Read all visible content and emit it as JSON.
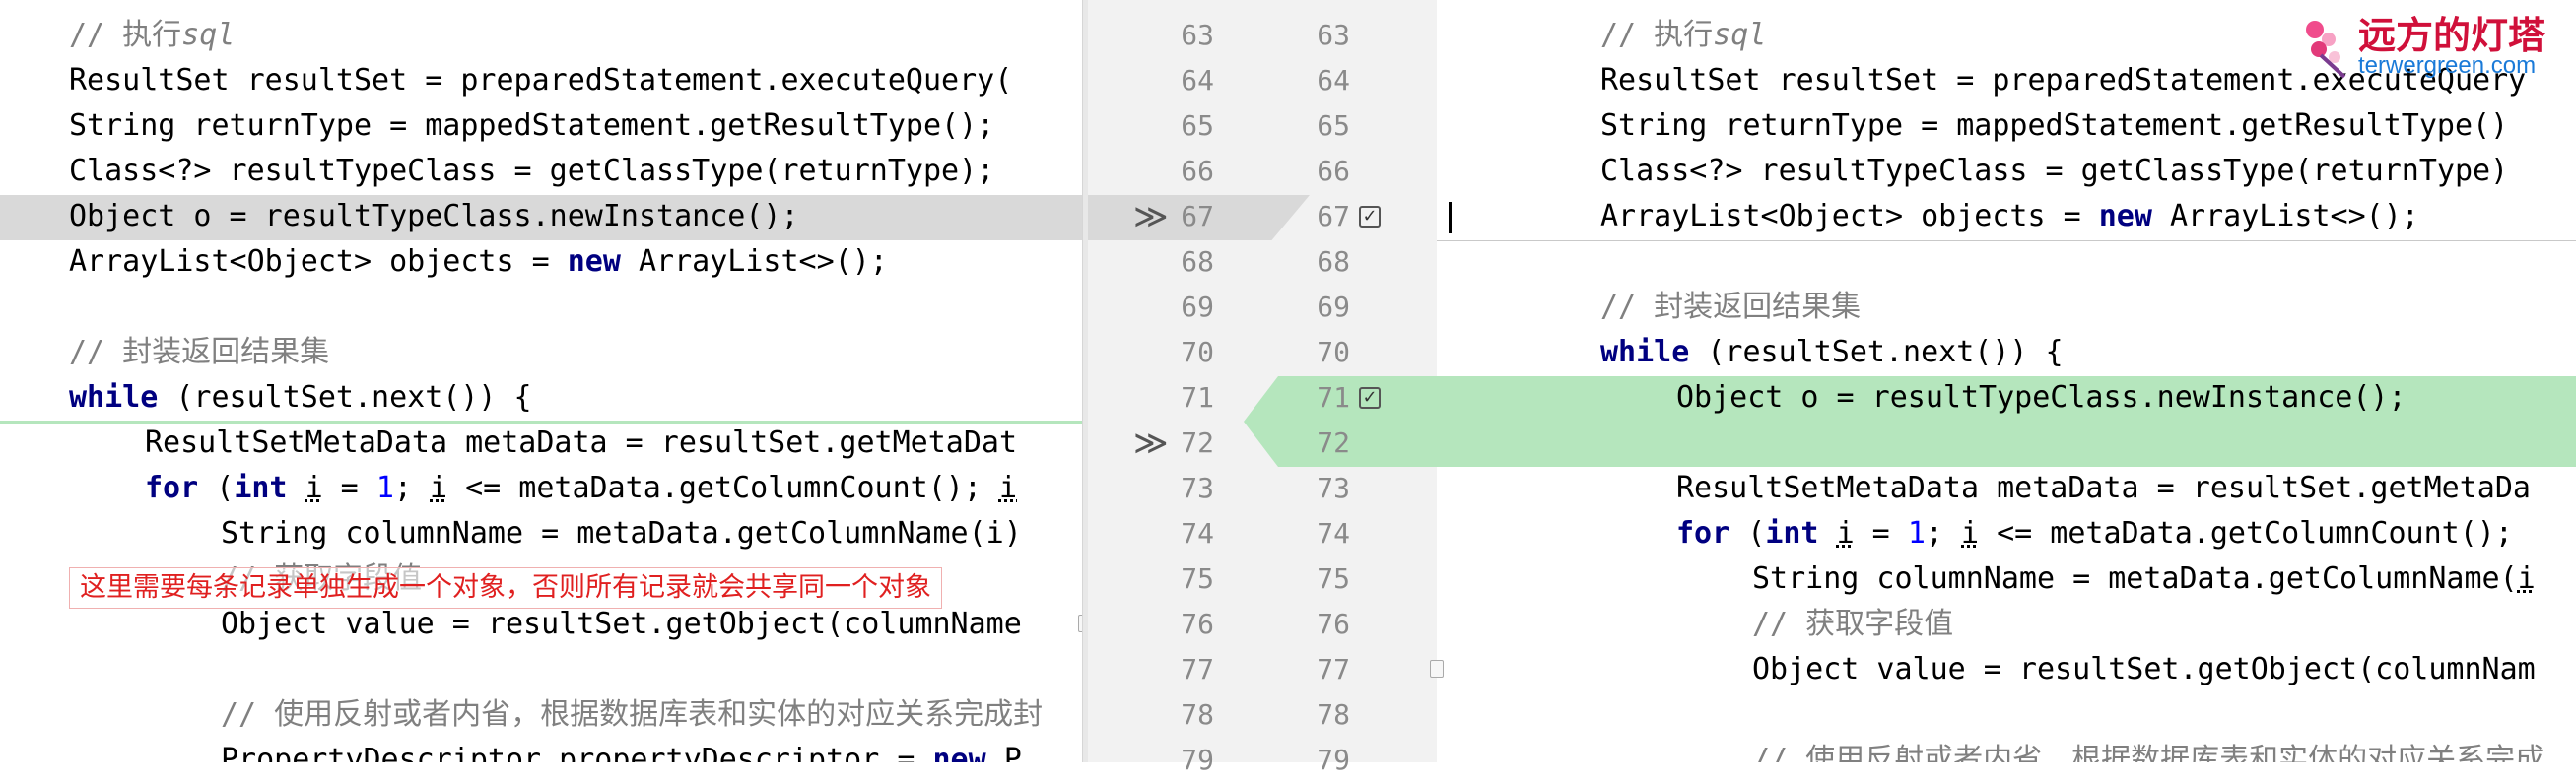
{
  "left": {
    "lines": [
      {
        "id": "l63",
        "text": ""
      },
      {
        "id": "l64",
        "text": "ResultSet resultSet = preparedStatement.executeQuery("
      },
      {
        "id": "l65",
        "text": "String returnType = mappedStatement.getResultType();"
      },
      {
        "id": "l66",
        "text": "Class<?> resultTypeClass = getClassType(returnType);"
      },
      {
        "id": "l67",
        "text": "Object o = resultTypeClass.newInstance();"
      },
      {
        "id": "l68a",
        "text": "ArrayList<Object> objects = "
      },
      {
        "id": "l68kw",
        "text": "new"
      },
      {
        "id": "l68b",
        "text": " ArrayList<>();"
      },
      {
        "id": "l70c",
        "text": "// 封装返回结果集"
      },
      {
        "id": "l71kw",
        "text": "while"
      },
      {
        "id": "l71b",
        "text": " (resultSet.next()) {"
      },
      {
        "id": "l72",
        "text": "ResultSetMetaData metaData = resultSet.getMetaDat"
      },
      {
        "id": "l73kw",
        "text": "for"
      },
      {
        "id": "l73b",
        "text": " ("
      },
      {
        "id": "l73int",
        "text": "int"
      },
      {
        "id": "l73c",
        "text": " "
      },
      {
        "id": "l73i1",
        "text": "i"
      },
      {
        "id": "l73d",
        "text": " = "
      },
      {
        "id": "l73one",
        "text": "1"
      },
      {
        "id": "l73e",
        "text": "; "
      },
      {
        "id": "l73i2",
        "text": "i"
      },
      {
        "id": "l73f",
        "text": " <= metaData.getColumnCount(); "
      },
      {
        "id": "l73i3",
        "text": "i"
      },
      {
        "id": "l74",
        "text": "String columnName = metaData.getColumnName(i)"
      },
      {
        "id": "l75c",
        "text": "// 获取字段值"
      },
      {
        "id": "l76",
        "text": "Object value = resultSet.getObject(columnName"
      },
      {
        "id": "l78c",
        "text": "// 使用反射或者内省，根据数据库表和实体的对应关系完成封"
      },
      {
        "id": "l79",
        "text": "PropertyDescriptor propertyDescriptor = "
      },
      {
        "id": "l79kw",
        "text": "new"
      },
      {
        "id": "l79b",
        "text": " P"
      }
    ],
    "comment_exec_prefix": "// 执行",
    "comment_exec_sql": "sql"
  },
  "right": {
    "comment_exec_prefix": "// 执行",
    "comment_exec_sql": "sql",
    "l64": "ResultSet resultSet = preparedStatement.executeQuery",
    "l65": "String returnType = mappedStatement.getResultType()",
    "l66": "Class<?> resultTypeClass = getClassType(returnType)",
    "l67a": "ArrayList<Object> objects = ",
    "l67kw": "new",
    "l67b": " ArrayList<>();",
    "l69c": "// 封装返回结果集",
    "l70kw": "while",
    "l70b": " (resultSet.next()) {",
    "l71": "Object o = resultTypeClass.newInstance();",
    "l73": "ResultSetMetaData metaData = resultSet.getMetaDa",
    "l74kw": "for",
    "l74b": " (",
    "l74int": "int",
    "l74c": " ",
    "l74i1": "i",
    "l74d": " = ",
    "l74one": "1",
    "l74e": "; ",
    "l74i2": "i",
    "l74f": " <= metaData.getColumnCount();",
    "l75": "String columnName = metaData.getColumnName(",
    "l75i": "i",
    "l76c": "// 获取字段值",
    "l77": "Object value = resultSet.getObject(columnNam",
    "l79c": "// 使用反射或者内省，根据数据库表和实体的对应关系完成"
  },
  "gutter": {
    "left_numbers": [
      "63",
      "64",
      "65",
      "66",
      "67",
      "68",
      "69",
      "70",
      "71",
      "72",
      "73",
      "74",
      "75",
      "76",
      "77",
      "78",
      "79"
    ],
    "right_numbers": [
      "63",
      "64",
      "65",
      "66",
      "67",
      "68",
      "69",
      "70",
      "71",
      "72",
      "73",
      "74",
      "75",
      "76",
      "77",
      "78",
      "79"
    ],
    "arrow_glyph": "≫",
    "check_glyph": "✓"
  },
  "annotation": "这里需要每条记录单独生成一个对象，否则所有记录就会共享同一个对象",
  "watermark": {
    "title": "远方的灯塔",
    "url": "terwergreen.com"
  },
  "colors": {
    "changed_gray": "#d9d9d9",
    "added_green": "#b5e6bd",
    "keyword": "#000080",
    "comment": "#808080",
    "number": "#0000ff",
    "annotation_red": "#e02020"
  }
}
